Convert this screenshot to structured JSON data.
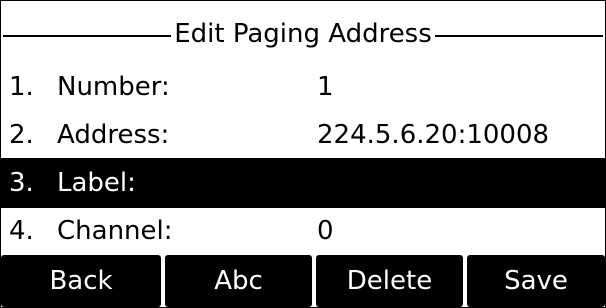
{
  "title": "Edit Paging Address",
  "rows": [
    {
      "num": "1.",
      "label": "Number:",
      "value": "1",
      "selected": false
    },
    {
      "num": "2.",
      "label": "Address:",
      "value": "224.5.6.20:10008",
      "selected": false
    },
    {
      "num": "3.",
      "label": "Label:",
      "value": "",
      "selected": true
    },
    {
      "num": "4.",
      "label": "Channel:",
      "value": "0",
      "selected": false
    }
  ],
  "softkeys": [
    "Back",
    "Abc",
    "Delete",
    "Save"
  ],
  "colors": {
    "background": "#ffffff",
    "foreground": "#000000",
    "highlight": "#000000",
    "highlight_text": "#ffffff"
  }
}
